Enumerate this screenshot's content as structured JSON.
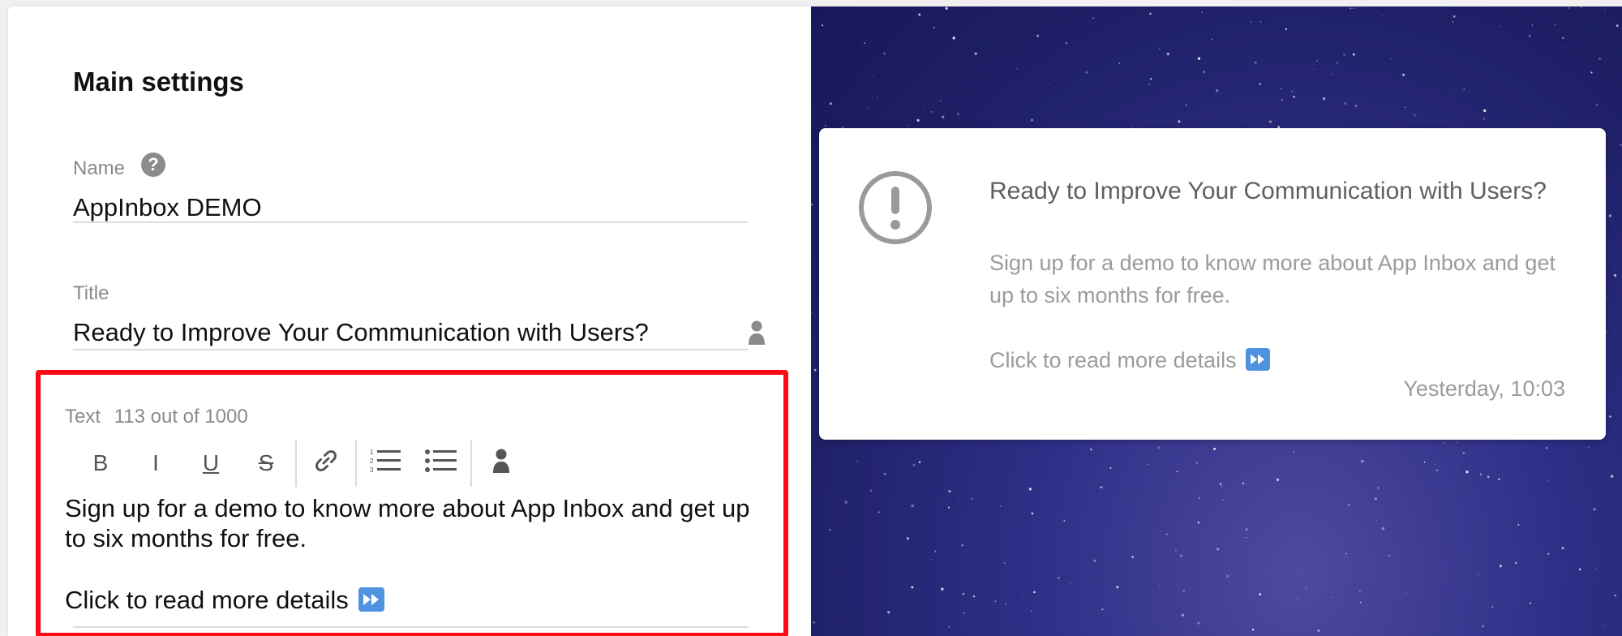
{
  "settings": {
    "title": "Main settings",
    "name": {
      "label": "Name",
      "value": "AppInbox DEMO",
      "help_icon": "question-circle-icon"
    },
    "title_field": {
      "label": "Title",
      "value": "Ready to Improve Your Communication with Users?",
      "personalize_icon": "person-icon"
    },
    "text_field": {
      "label": "Text",
      "counter": "113 out of 1000",
      "toolbar": {
        "bold": "B",
        "italic": "I",
        "underline": "U",
        "strike": "S",
        "link_icon": "link-icon",
        "ordered_list_icon": "ordered-list-icon",
        "bullet_list_icon": "bullet-list-icon",
        "personalize_icon": "person-icon"
      },
      "paragraph_1": "Sign up for a demo to know more about App Inbox and get up to six months for free.",
      "paragraph_2": "Click to read more details",
      "emoji_icon": "fast-forward-emoji-icon"
    }
  },
  "preview": {
    "icon": "exclamation-circle-icon",
    "title": "Ready to Improve Your Communication with Users?",
    "body_1": "Sign up for a demo to know more about App Inbox and get up to six months for free.",
    "body_2": "Click to read more details",
    "emoji_icon": "fast-forward-emoji-icon",
    "timestamp": "Yesterday, 10:03"
  },
  "colors": {
    "highlight_border": "#ff0a14",
    "preview_background": "#2e2e86",
    "emoji_blue": "#4f92e0"
  }
}
